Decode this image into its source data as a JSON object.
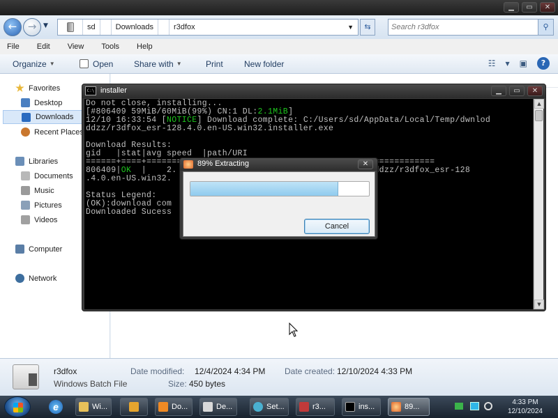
{
  "explorer": {
    "address": {
      "crumbs": [
        "sd",
        "Downloads",
        "r3dfox"
      ]
    },
    "search": {
      "placeholder": "Search r3dfox"
    },
    "menu": [
      "File",
      "Edit",
      "View",
      "Tools",
      "Help"
    ],
    "toolbar": {
      "organize": "Organize",
      "open": "Open",
      "share_with": "Share with",
      "print": "Print",
      "new_folder": "New folder"
    },
    "nav": {
      "favorites": "Favorites",
      "desktop": "Desktop",
      "downloads": "Downloads",
      "recent": "Recent Places",
      "libraries": "Libraries",
      "documents": "Documents",
      "music": "Music",
      "pictures": "Pictures",
      "videos": "Videos",
      "computer": "Computer",
      "network": "Network"
    },
    "details": {
      "name": "r3dfox",
      "type": "Windows Batch File",
      "modified_label": "Date modified:",
      "modified_value": "12/4/2024 4:34 PM",
      "size_label": "Size:",
      "size_value": "450 bytes",
      "created_label": "Date created:",
      "created_value": "12/10/2024 4:33 PM"
    }
  },
  "console": {
    "title": "installer",
    "icon_label": "C:\\",
    "line1": "Do not close, installing...",
    "line2a": "[#806409 59MiB/60MiB(99%) CN:1 DL:",
    "line2b": "2.1MiB",
    "line2c": "]",
    "line3a": "12/10 16:33:54 [",
    "line3b": "NOTICE",
    "line3c": "] Download complete: C:/Users/sd/AppData/Local/Temp/dwnlod",
    "line4": "ddzz/r3dfox_esr-128.4.0.en-US.win32.installer.exe",
    "line5": "",
    "line6": "Download Results:",
    "line7": "gid   |stat|avg speed  |path/URI",
    "line8": "======+====+===========+=============================================",
    "line9a": "806409|",
    "line9b": "OK",
    "line9c": "  |    2.                               p/dwnlodddzz/r3dfox_esr-128",
    "line10": ".4.0.en-US.win32.",
    "line11": "",
    "line12": "Status Legend:",
    "line13": "(OK):download com",
    "line14": "Downloaded Sucess"
  },
  "dialog": {
    "title": "89% Extracting",
    "progress": 0.83,
    "cancel": "Cancel"
  },
  "taskbar": {
    "items": [
      "Wi...",
      "",
      "Do...",
      "De...",
      "Set...",
      "r3...",
      "ins...",
      "89..."
    ],
    "time": "4:33 PM",
    "date": "12/10/2024"
  },
  "colors": {
    "console_green": "#1ec71e",
    "progress_fill": "#8fcbee",
    "titlebar_dark": "#2c2c2c",
    "explorer_bg": "#eef3f8"
  },
  "icons": [
    "back-arrow-icon",
    "forward-arrow-icon",
    "refresh-icon",
    "search-icon",
    "help-icon",
    "console-icon",
    "extract-icon",
    "windows-logo-icon"
  ]
}
